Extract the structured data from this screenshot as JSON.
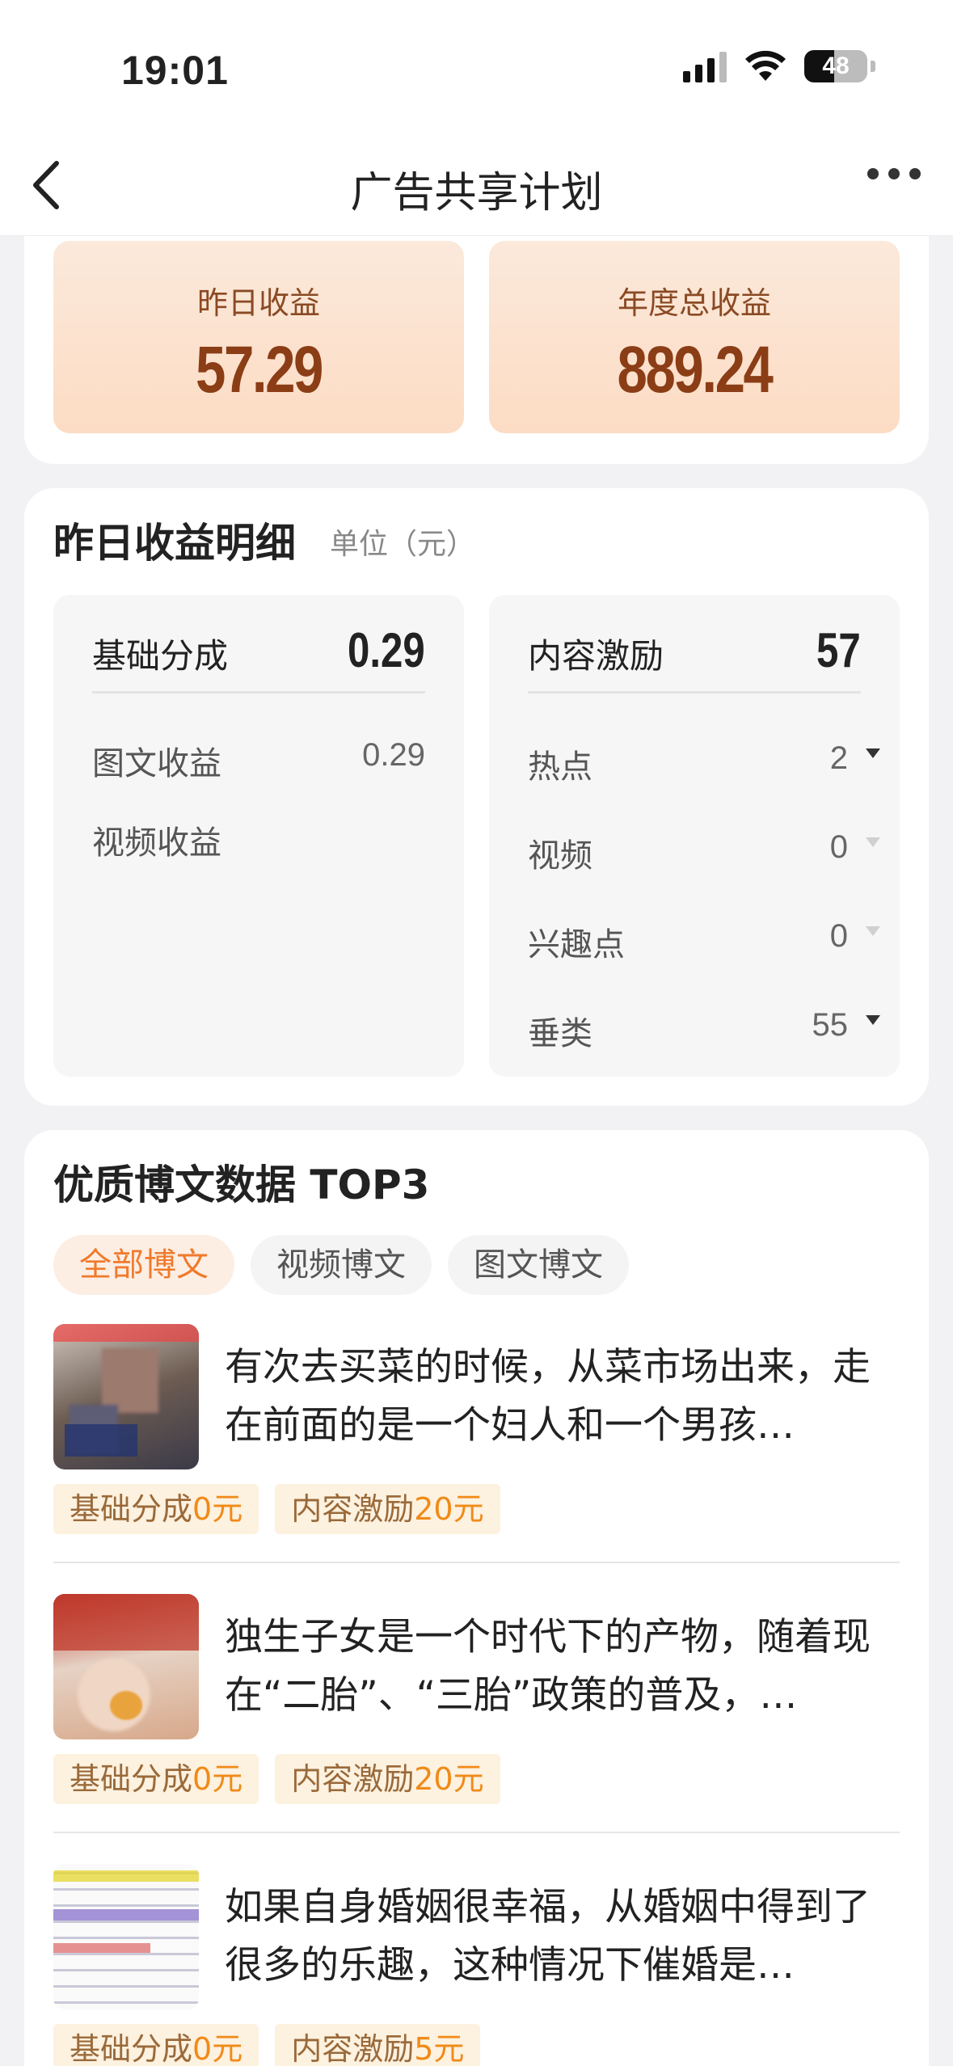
{
  "status_bar": {
    "time": "19:01",
    "battery": "48"
  },
  "nav": {
    "title": "广告共享计划"
  },
  "summary": {
    "yesterday_label": "昨日收益",
    "yesterday_value": "57.29",
    "annual_label": "年度总收益",
    "annual_value": "889.24"
  },
  "detail": {
    "title": "昨日收益明细",
    "unit": "单位（元）",
    "left": {
      "head_label": "基础分成",
      "head_value": "0.29",
      "rows": [
        {
          "label": "图文收益",
          "value": "0.29"
        },
        {
          "label": "视频收益",
          "value": ""
        }
      ]
    },
    "right": {
      "head_label": "内容激励",
      "head_value": "57",
      "rows": [
        {
          "label": "热点",
          "value": "2"
        },
        {
          "label": "视频",
          "value": "0"
        },
        {
          "label": "兴趣点",
          "value": "0"
        },
        {
          "label": "垂类",
          "value": "55"
        }
      ]
    }
  },
  "top_posts": {
    "title": "优质博文数据 TOP3",
    "tabs": [
      "全部博文",
      "视频博文",
      "图文博文"
    ],
    "posts": [
      {
        "text": "有次去买菜的时候，从菜市场出来，走在前面的是一个妇人和一个男孩…",
        "base_label": "基础分成",
        "base_value": "0元",
        "incentive_label": "内容激励",
        "incentive_value": "20元"
      },
      {
        "text": "独生子女是一个时代下的产物，随着现在“二胎”、“三胎”政策的普及，…",
        "base_label": "基础分成",
        "base_value": "0元",
        "incentive_label": "内容激励",
        "incentive_value": "20元"
      },
      {
        "text": "如果自身婚姻很幸福，从婚姻中得到了很多的乐趣，这种情况下催婚是…",
        "base_label": "基础分成",
        "base_value": "0元",
        "incentive_label": "内容激励",
        "incentive_value": "5元"
      }
    ]
  }
}
